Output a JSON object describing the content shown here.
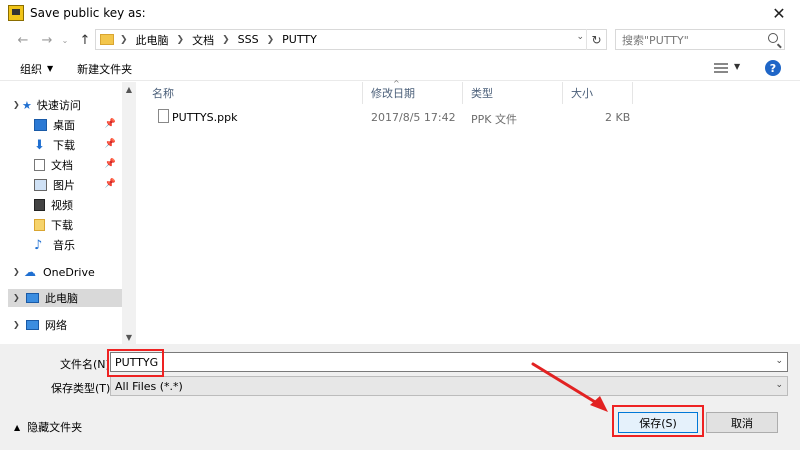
{
  "window": {
    "title": "Save public key as:"
  },
  "address": {
    "crumbs": [
      "此电脑",
      "文档",
      "SSS",
      "PUTTY"
    ]
  },
  "search": {
    "placeholder": "搜索\"PUTTY\""
  },
  "toolbar": {
    "organize_label": "组织",
    "new_folder_label": "新建文件夹"
  },
  "sidebar": {
    "items": [
      {
        "label": "快速访问",
        "icon": "star-icon",
        "pinned": false
      },
      {
        "label": "桌面",
        "icon": "desktop-icon",
        "pinned": true
      },
      {
        "label": "下载",
        "icon": "download-icon",
        "pinned": true
      },
      {
        "label": "文档",
        "icon": "document-icon",
        "pinned": true
      },
      {
        "label": "图片",
        "icon": "picture-icon",
        "pinned": true
      },
      {
        "label": "视频",
        "icon": "video-icon",
        "pinned": false
      },
      {
        "label": "下载",
        "icon": "folder-icon",
        "pinned": false
      },
      {
        "label": "音乐",
        "icon": "music-icon",
        "pinned": false
      },
      {
        "label": "OneDrive",
        "icon": "cloud-icon",
        "pinned": false
      },
      {
        "label": "此电脑",
        "icon": "computer-icon",
        "pinned": false
      },
      {
        "label": "网络",
        "icon": "network-icon",
        "pinned": false
      }
    ]
  },
  "columns": {
    "name": "名称",
    "modified": "修改日期",
    "type": "类型",
    "size": "大小"
  },
  "files": [
    {
      "name": "PUTTYS.ppk",
      "modified": "2017/8/5 17:42",
      "type": "PPK 文件",
      "size": "2 KB"
    }
  ],
  "form": {
    "filename_label": "文件名(N):",
    "filename_value": "PUTTYG",
    "filetype_label": "保存类型(T):",
    "filetype_value": "All Files (*.*)"
  },
  "footer": {
    "hide_folders_label": "隐藏文件夹",
    "save_label": "保存(S)",
    "cancel_label": "取消"
  },
  "colors": {
    "annotation": "#e22222",
    "accent": "#0078d7"
  }
}
